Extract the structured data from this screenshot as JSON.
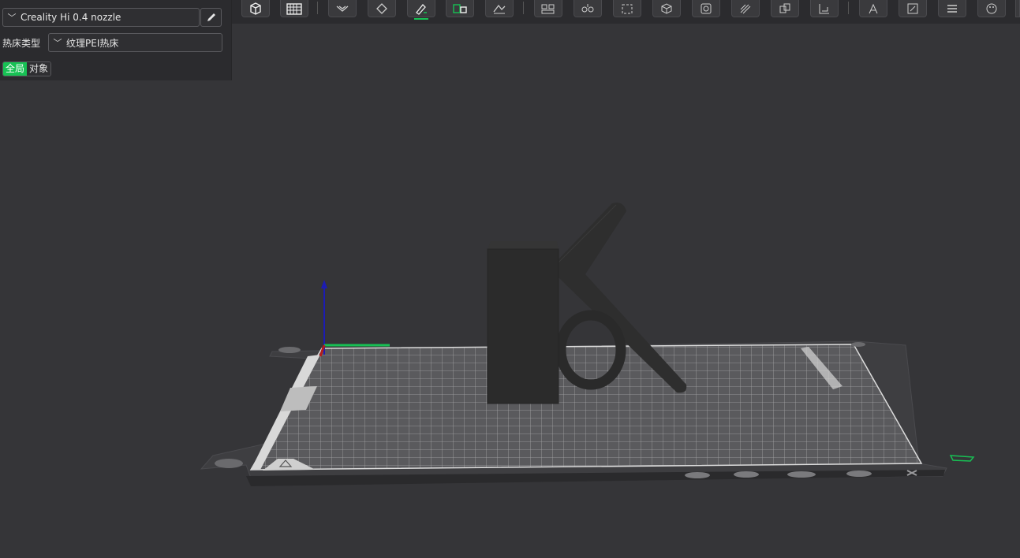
{
  "sidebar": {
    "printer_preset": "Creality Hi 0.4 nozzle",
    "bed_type_label": "热床类型",
    "bed_type_value": "纹理PEI热床",
    "scope_global": "全局",
    "scope_object": "对象"
  },
  "toolbar": {
    "buttons": [
      {
        "name": "add-cube-icon"
      },
      {
        "name": "arrange-grid-icon"
      },
      {
        "name": "auto-orient-icon"
      },
      {
        "name": "layout-plate-icon"
      },
      {
        "name": "paint-brush-icon",
        "active": true
      },
      {
        "name": "split-objects-icon"
      },
      {
        "name": "slice-plane-icon"
      },
      {
        "name": "object-group-icon"
      },
      {
        "name": "support-settings-icon"
      },
      {
        "name": "scale-frame-icon"
      },
      {
        "name": "view-3d-icon"
      },
      {
        "name": "hollow-icon"
      },
      {
        "name": "seam-paint-icon"
      },
      {
        "name": "assembly-icon"
      },
      {
        "name": "measure-icon"
      },
      {
        "name": "text-tool-icon"
      },
      {
        "name": "svg-emboss-icon"
      },
      {
        "name": "layers-icon"
      },
      {
        "name": "color-paint-icon"
      }
    ]
  },
  "colors": {
    "accent": "#17c154",
    "panel_bg": "#2b2b2e",
    "viewport_bg": "#353538",
    "model": "#2c2c2c",
    "axis_z": "#1c1cb4",
    "axis_x": "#b41c1c",
    "axis_y": "#17c154"
  }
}
